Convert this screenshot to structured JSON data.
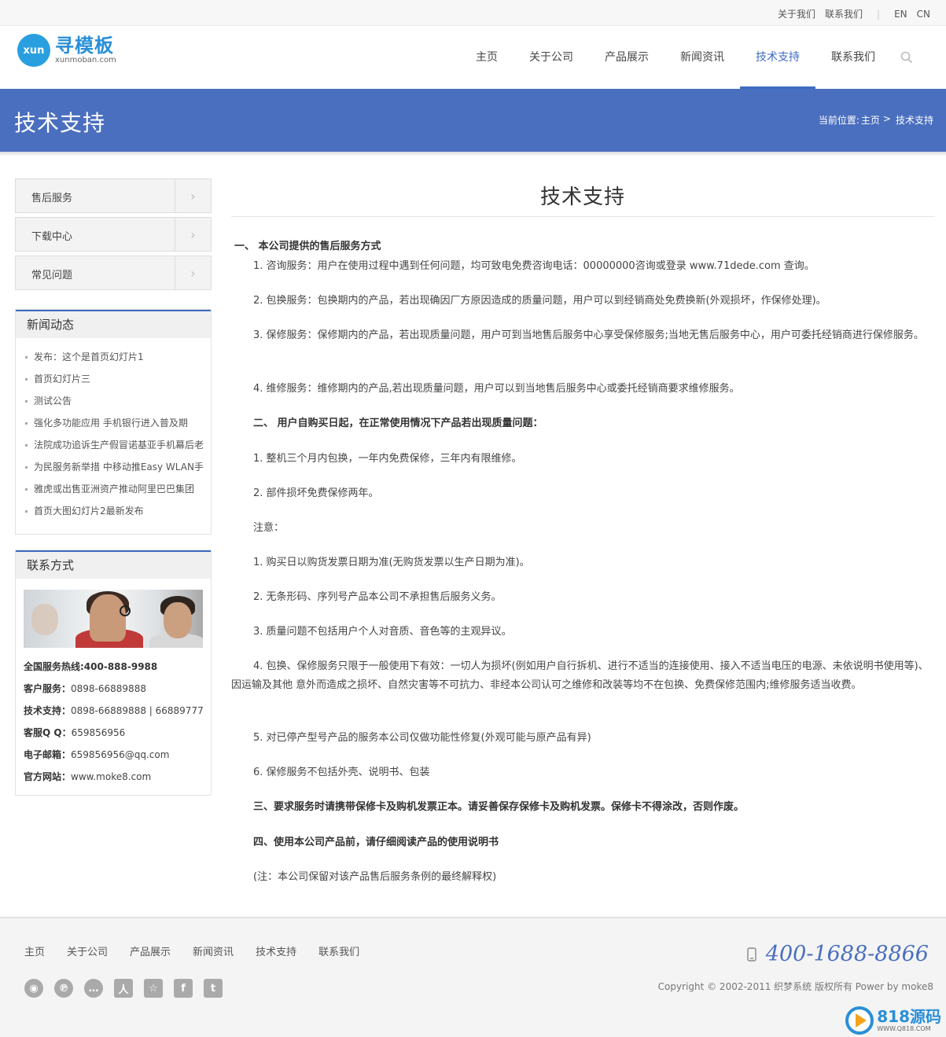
{
  "topbar": {
    "about": "关于我们",
    "contact": "联系我们",
    "sep": "|",
    "en": "EN",
    "cn": "CN"
  },
  "logo": {
    "badge": "xun",
    "cn": "寻模板",
    "en": "xunmoban.com"
  },
  "nav": {
    "items": [
      "主页",
      "关于公司",
      "产品展示",
      "新闻资讯",
      "技术支持",
      "联系我们"
    ],
    "active_index": 4,
    "search_icon": "search-icon",
    "accent": "#3d6cc0"
  },
  "banner": {
    "title": "技术支持",
    "breadcrumb_prefix": "当前位置:",
    "breadcrumb_home": "主页",
    "breadcrumb_sep": ">",
    "breadcrumb_current": "技术支持",
    "color": "#4a6fbf"
  },
  "sidebar": {
    "menu": [
      "售后服务",
      "下载中心",
      "常见问题"
    ],
    "arrow": "›",
    "news_title": "新闻动态",
    "news": [
      "发布：这个是首页幻灯片1",
      "首页幻灯片三",
      "测试公告",
      "强化多功能应用 手机银行进入普及期",
      "法院成功追诉生产假冒诺基亚手机幕后老",
      "为民服务新举措 中移动推Easy WLAN手",
      "雅虎或出售亚洲资产推动阿里巴巴集团",
      "首页大图幻灯片2最新发布"
    ],
    "contact_title": "联系方式",
    "contact": {
      "hotline": "全国服务热线:400-888-9988",
      "service_label": "客户服务：",
      "service": "0898-66889888",
      "tech_label": "技术支持：",
      "tech": "0898-66889888 | 66889777",
      "qq_label": "客服Q Q：",
      "qq": "659856956",
      "email_label": "电子邮箱：",
      "email": "659856956@qq.com",
      "site_label": "官方网站：",
      "site": "www.moke8.com"
    }
  },
  "article": {
    "title": "技术支持",
    "paragraphs": [
      "一、  本公司提供的售后服务方式",
      "1. 咨询服务：用户在使用过程中遇到任何问题，均可致电免费咨询电话：00000000咨询或登录 www.71dede.com 查询。",
      "2. 包换服务：包换期内的产品，若出现确因厂方原因造成的质量问题，用户可以到经销商处免费换新(外观损坏，作保修处理)。",
      "3. 保修服务：保修期内的产品，若出现质量问题，用户可到当地售后服务中心享受保修服务;当地无售后服务中心，用户可委托经销商进行保修服务。",
      "4. 维修服务：维修期内的产品,若出现质量问题，用户可以到当地售后服务中心或委托经销商要求维修服务。",
      "二、  用户自购买日起，在正常使用情况下产品若出现质量问题：",
      "1. 整机三个月内包换，一年内免费保修，三年内有限维修。",
      "2. 部件损坏免费保修两年。",
      "注意：",
      "1. 购买日以购货发票日期为准(无购货发票以生产日期为准)。",
      "2. 无条形码、序列号产品本公司不承担售后服务义务。",
      "3. 质量问题不包括用户个人对音质、音色等的主观异议。",
      "4. 包换、保修服务只限于一般使用下有效：一切人为损坏(例如用户自行拆机、进行不适当的连接使用、接入不适当电压的电源、未依说明书使用等)、因运输及其他 意外而造成之损坏、自然灾害等不可抗力、非经本公司认可之维修和改装等均不在包换、免费保修范围内;维修服务适当收费。",
      "5. 对已停产型号产品的服务本公司仅做功能性修复(外观可能与原产品有异)",
      "6. 保修服务不包括外壳、说明书、包装",
      "三、要求服务时请携带保修卡及购机发票正本。请妥善保存保修卡及购机发票。保修卡不得涂改，否则作废。",
      "四、使用本公司产品前，请仔细阅读产品的使用说明书",
      "(注：本公司保留对该产品售后服务条例的最终解释权)"
    ]
  },
  "footer": {
    "nav": [
      "主页",
      "关于公司",
      "产品展示",
      "新闻资讯",
      "技术支持",
      "联系我们"
    ],
    "social_icons": [
      "weibo-icon",
      "pinterest-icon",
      "chat-icon",
      "renren-icon",
      "star-icon",
      "facebook-icon",
      "twitter-icon"
    ],
    "phone_icon": "mobile-phone-icon",
    "phone": "400-1688-8866",
    "copyright": "Copyright © 2002-2011 织梦系统 版权所有 Power by moke8",
    "watermark_main": "818源码",
    "watermark_sub": "WWW.Q818.COM"
  }
}
